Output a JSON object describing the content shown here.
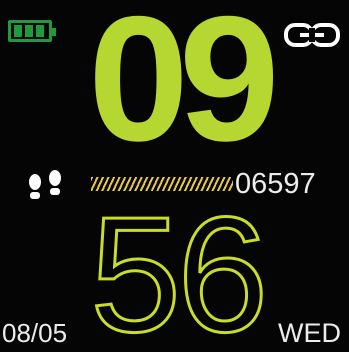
{
  "status": {
    "battery_icon": "battery-icon",
    "battery_level": 0.75,
    "battery_color": "#1f9a3c",
    "link_icon": "link-icon"
  },
  "time": {
    "hour": "09",
    "minute": "56",
    "hour_color": "#b6d631",
    "minute_color": "#c8dc2a"
  },
  "activity": {
    "steps_icon": "footsteps-icon",
    "steps": "06597",
    "progress_color": "#e8c84a"
  },
  "date": {
    "day_month": "08/05",
    "weekday": "WED"
  }
}
